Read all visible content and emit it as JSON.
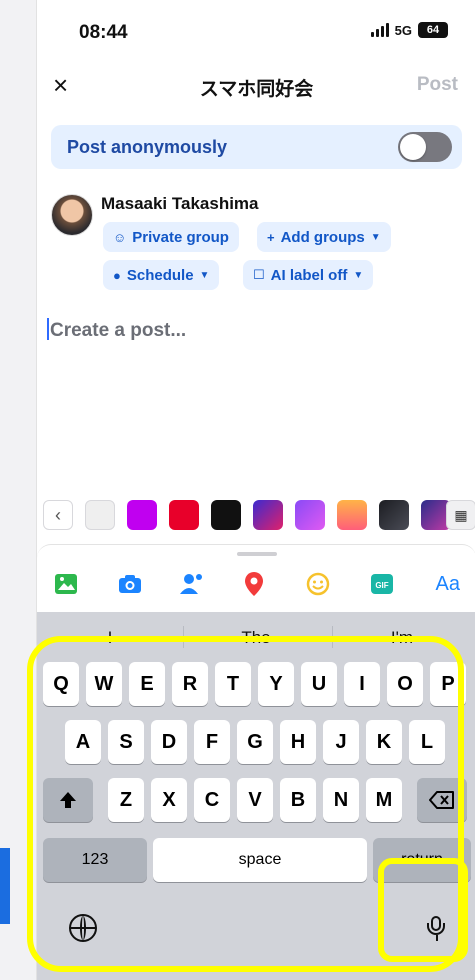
{
  "status": {
    "time": "08:44",
    "network": "5G",
    "battery": "64"
  },
  "header": {
    "title": "スマホ同好会",
    "post_label": "Post",
    "close_icon": "×"
  },
  "anon": {
    "label": "Post anonymously",
    "toggle_on": false
  },
  "user": {
    "name": "Masaaki Takashima"
  },
  "chips": {
    "private_group": "Private group",
    "add_groups": "Add groups",
    "schedule": "Schedule",
    "ai_label": "AI label off"
  },
  "composer": {
    "placeholder": "Create a post..."
  },
  "swatch_colors": [
    "#efefef",
    "#c000f0",
    "#e8002a",
    "#111111",
    "#6b2bc6",
    "#b94af6",
    "#ff8a2a",
    "#2c2d33",
    "#6a2ad6"
  ],
  "tools": {
    "aa_label": "Aa",
    "colors": {
      "photo": "#2db84d",
      "camera": "#1b84ff",
      "tag": "#1b84ff",
      "location": "#f23b3b",
      "feeling": "#f6c22c",
      "gif": "#19b6a6"
    }
  },
  "suggestions": [
    "I",
    "The",
    "I'm"
  ],
  "keyboard": {
    "row1": [
      "Q",
      "W",
      "E",
      "R",
      "T",
      "Y",
      "U",
      "I",
      "O",
      "P"
    ],
    "row2": [
      "A",
      "S",
      "D",
      "F",
      "G",
      "H",
      "J",
      "K",
      "L"
    ],
    "row3": [
      "Z",
      "X",
      "C",
      "V",
      "B",
      "N",
      "M"
    ],
    "numbers_label": "123",
    "space_label": "space",
    "return_label": "return"
  },
  "highlight_color": "#ffff00"
}
